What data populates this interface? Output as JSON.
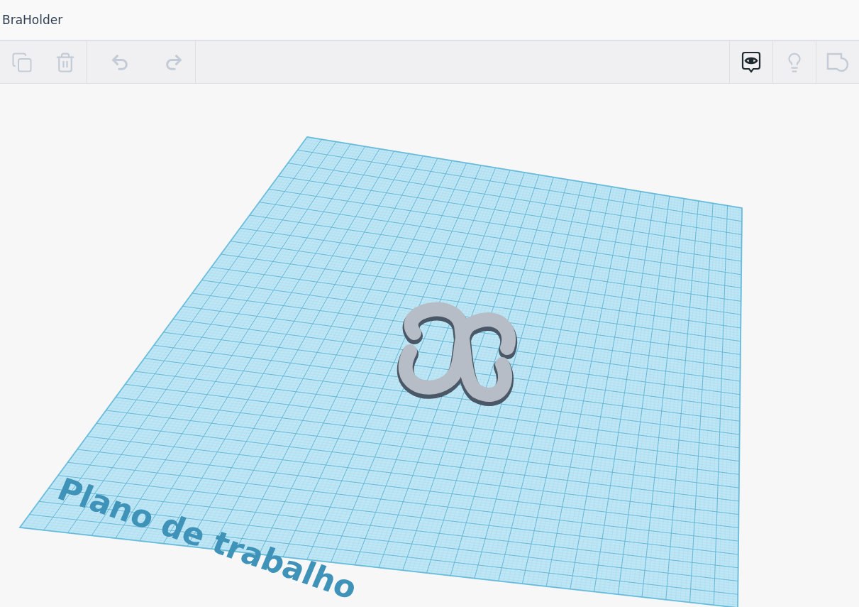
{
  "title": "BraHolder",
  "toolbar": {
    "left_groups": [
      [
        {
          "kind": "copy",
          "disabled": true
        },
        {
          "kind": "delete",
          "disabled": true
        }
      ],
      [
        {
          "kind": "undo",
          "disabled": true
        },
        {
          "kind": "redo",
          "disabled": true
        }
      ]
    ],
    "right": [
      {
        "kind": "notes",
        "selected": true
      },
      {
        "kind": "bulb",
        "selected": false
      },
      {
        "kind": "shape",
        "selected": false
      }
    ]
  },
  "workplane": {
    "label": "Plano de trabalho"
  }
}
